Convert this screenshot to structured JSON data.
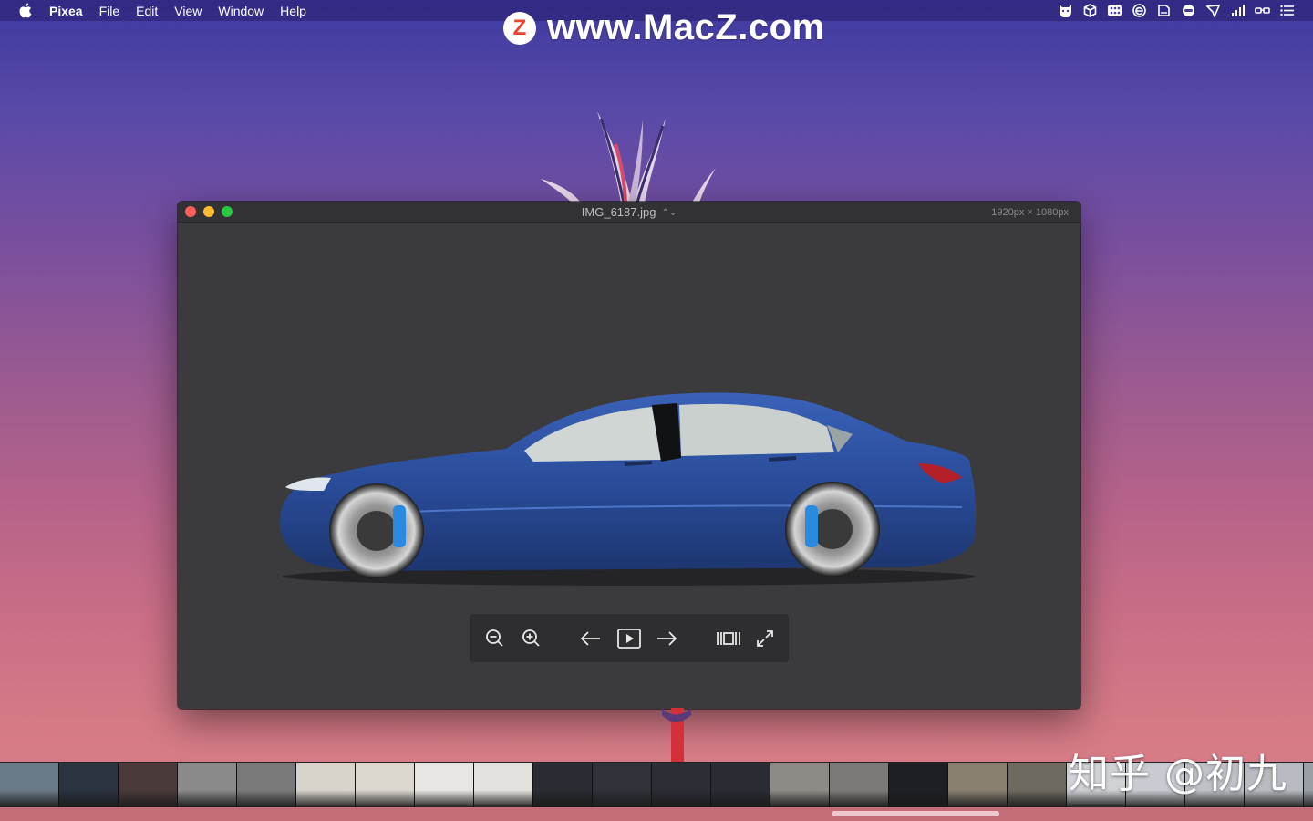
{
  "menubar": {
    "app_name": "Pixea",
    "items": [
      "File",
      "Edit",
      "View",
      "Window",
      "Help"
    ],
    "status_icons": [
      "cat-icon",
      "cube-icon",
      "grid-icon",
      "e-icon",
      "drive-icon",
      "controller-icon",
      "cursor-icon",
      "signal-icon",
      "glasses-icon",
      "list-icon"
    ]
  },
  "watermark": {
    "logo_letter": "Z",
    "text": "www.MacZ.com"
  },
  "window": {
    "title": "IMG_6187.jpg",
    "title_chevron": "⌃⌄",
    "dimensions": "1920px × 1080px"
  },
  "toolbar": {
    "buttons": [
      "zoom-out",
      "zoom-in",
      "previous",
      "slideshow",
      "next",
      "fit-width",
      "fullscreen"
    ]
  },
  "filmstrip": {
    "thumbnail_colors": [
      "#6b7a88",
      "#2b3240",
      "#4a3a3a",
      "#8a8a8a",
      "#7a7a7a",
      "#d8d4cc",
      "#dcd8d0",
      "#e8e6e2",
      "#e4e2de",
      "#2a2c33",
      "#30323a",
      "#2c2e36",
      "#2a2c34",
      "#8e8a86",
      "#7c7a78",
      "#1e1f24",
      "#8a8072",
      "#6e6a60",
      "#d0d2d6",
      "#c8ccd2",
      "#bfc2c8",
      "#b8bcc2",
      "#9a9ea6"
    ],
    "scroll_position": 0.65
  },
  "corner_watermark": "知乎 @初九"
}
